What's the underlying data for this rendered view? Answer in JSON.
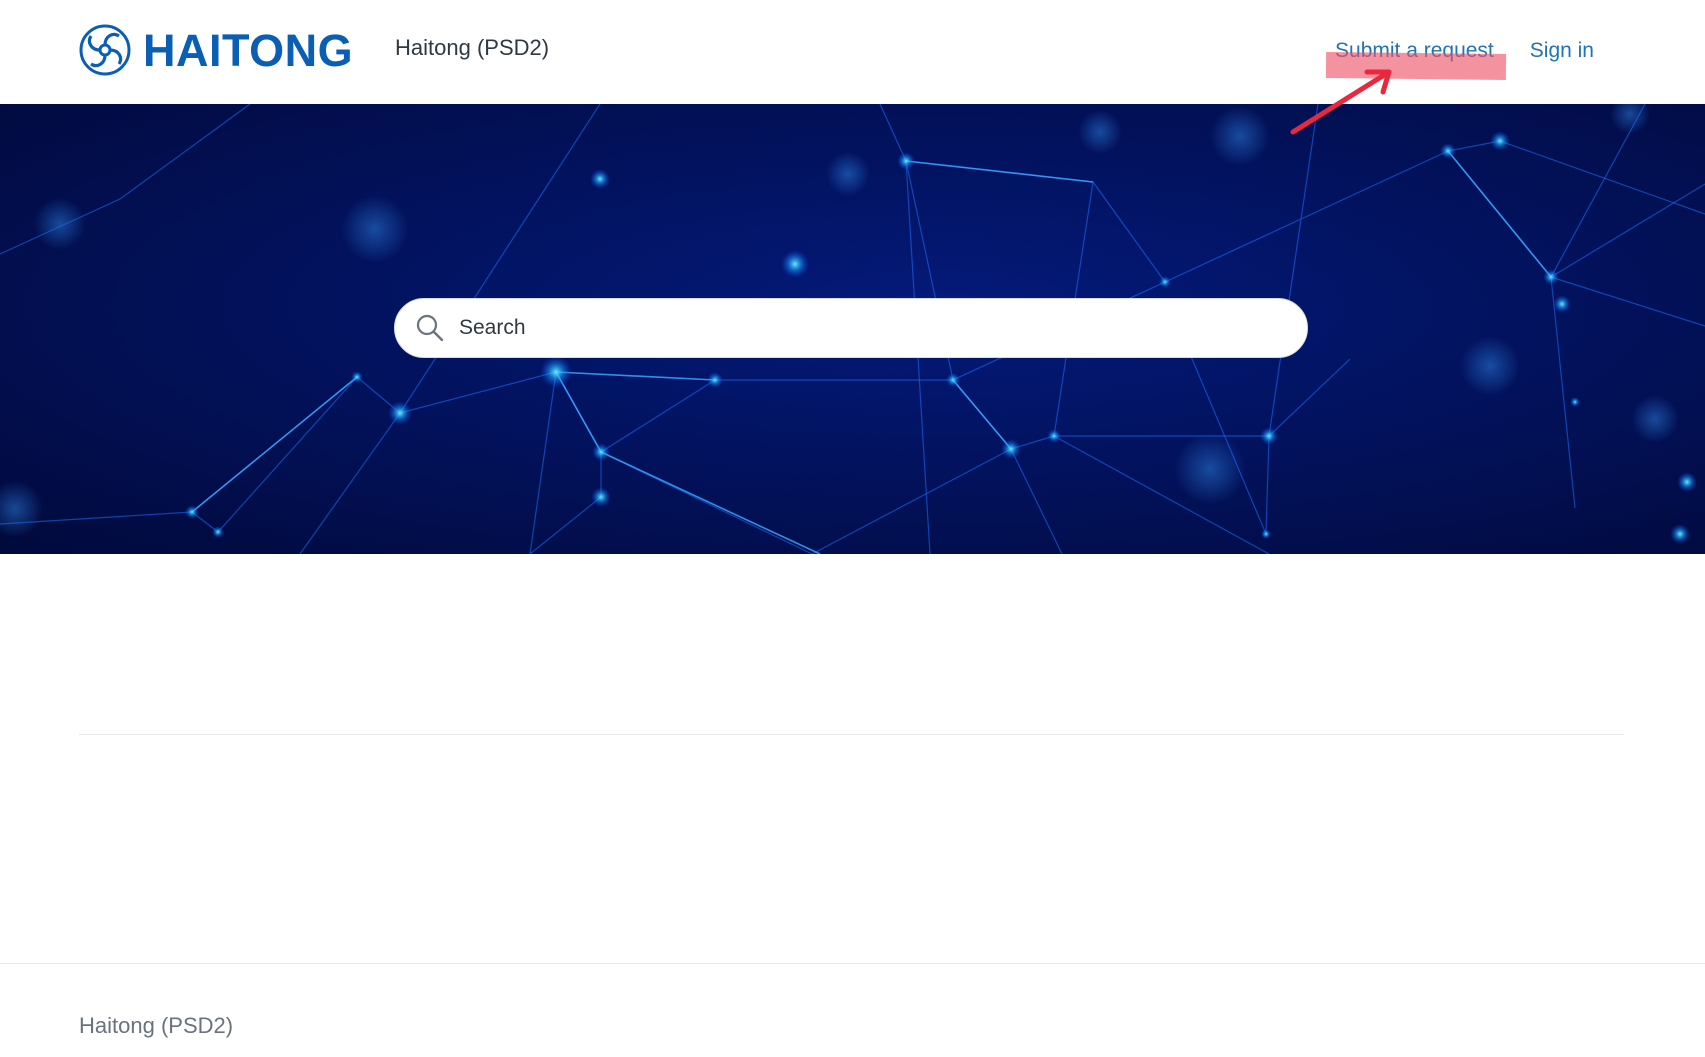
{
  "header": {
    "logo_text": "HAITONG",
    "brand_name": "Haitong (PSD2)",
    "nav": {
      "submit_request": "Submit a request",
      "sign_in": "Sign in"
    }
  },
  "hero": {
    "search": {
      "placeholder": "Search"
    }
  },
  "footer": {
    "brand_name": "Haitong (PSD2)"
  },
  "colors": {
    "brand_blue": "#0a5fb4",
    "link_blue": "#1f73b7",
    "hero_navy": "#02125e",
    "annotation_red": "#e8283c"
  },
  "icons": {
    "logo": "haitong-logo-icon",
    "search": "search-icon",
    "annotation": "arrow-icon"
  }
}
